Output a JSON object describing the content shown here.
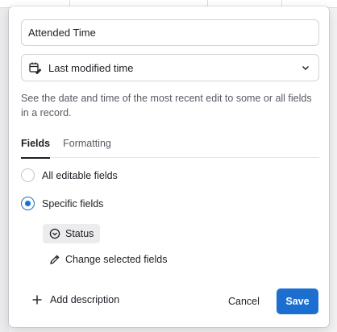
{
  "colors": {
    "accent": "#1c6fd1",
    "text": "#1d1f25",
    "muted_text": "#575a62",
    "chip_bg": "#ececee"
  },
  "field_editor": {
    "name_input": {
      "value": "Attended Time"
    },
    "type_select": {
      "icon": "calendar-edit-icon",
      "selected": "Last modified time",
      "chevron_icon": "chevron-down-icon"
    },
    "description": "See the date and time of the most recent edit to some or all fields in a record.",
    "tabs": [
      {
        "label": "Fields",
        "active": true
      },
      {
        "label": "Formatting",
        "active": false
      }
    ],
    "radio_options": [
      {
        "label": "All editable fields",
        "checked": false
      },
      {
        "label": "Specific fields",
        "checked": true
      }
    ],
    "selected_field_chip": {
      "icon": "status-circle-chevron-icon",
      "label": "Status"
    },
    "change_link": {
      "icon": "pencil-icon",
      "label": "Change selected fields"
    },
    "footer": {
      "add_description": {
        "icon": "plus-icon",
        "label": "Add description"
      },
      "cancel_label": "Cancel",
      "save_label": "Save"
    }
  }
}
